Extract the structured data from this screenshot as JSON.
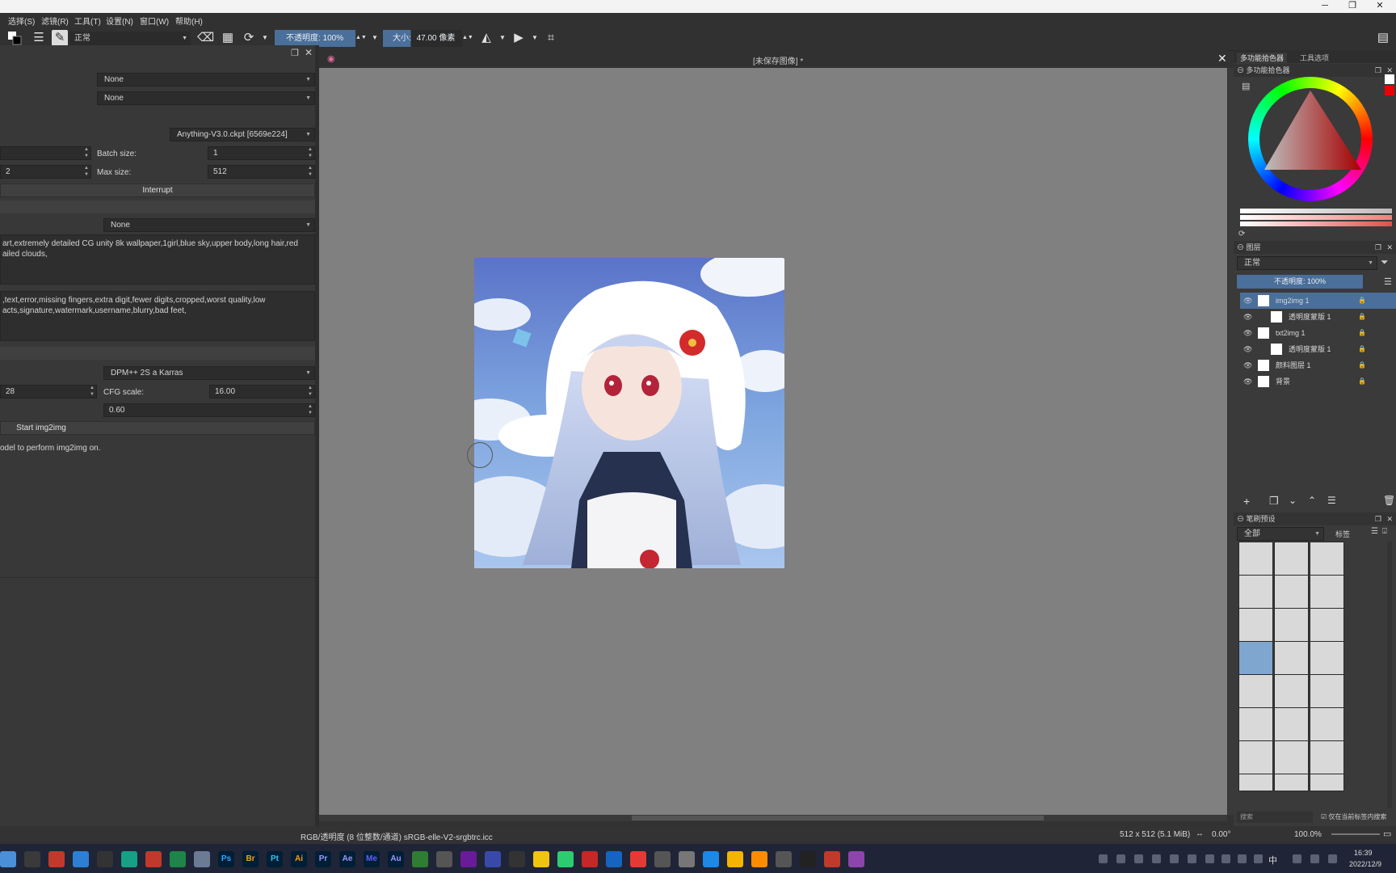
{
  "window": {
    "min": "─",
    "max": "❐",
    "close": "✕"
  },
  "menubar": [
    "选择(S)",
    "滤镜(R)",
    "工具(T)",
    "设置(N)",
    "窗口(W)",
    "帮助(H)"
  ],
  "toolbar": {
    "blend_mode": "正常",
    "opacity_label": "不透明度:",
    "opacity_value": "100%",
    "size_label": "大小:",
    "size_value": "47.00 像素"
  },
  "left_panel": {
    "combo1": "None",
    "combo2": "None",
    "model": "Anything-V3.0.ckpt [6569e224]",
    "batch_size_label": "Batch size:",
    "batch_size_value": "1",
    "max_size_label": "Max size:",
    "max_size_value": "512",
    "left_spin2_value": "2",
    "interrupt_label": "Interrupt",
    "combo3": "None",
    "prompt": "art,extremely detailed CG unity 8k wallpaper,1girl,blue sky,upper body,long hair,red\nailed clouds,",
    "negative_prompt": ",text,error,missing fingers,extra digit,fewer digits,cropped,worst quality,low\nacts,signature,watermark,username,blurry,bad feet,",
    "sampler": "DPM++ 2S a Karras",
    "steps_value": "28",
    "cfg_label": "CFG scale:",
    "cfg_value": "16.00",
    "denoise_value": "0.60",
    "start_label": "Start img2img",
    "info_text": "odel to perform img2img on."
  },
  "canvas": {
    "tab_title": "[未保存图像] *"
  },
  "status": {
    "color_info": "RGB/透明度 (8 位整数/通道)  sRGB-elle-V2-srgbtrc.icc",
    "image_size": "512 x 512 (5.1 MiB)",
    "rotation": "0.00°",
    "zoom": "100.0%"
  },
  "right_panel": {
    "tab1": "多功能拾色器",
    "tab2": "工具选项",
    "color_dock_title": "多功能拾色器",
    "layers_title": "图层",
    "layers_blend": "正常",
    "layers_opacity": "不透明度: 100%",
    "layers": [
      {
        "name": "img2img 1",
        "active": true,
        "indent": 0
      },
      {
        "name": "透明度蒙版 1",
        "active": false,
        "indent": 1
      },
      {
        "name": "txt2img 1",
        "active": false,
        "indent": 0
      },
      {
        "name": "透明度蒙版 1",
        "active": false,
        "indent": 1
      },
      {
        "name": "颜料图层 1",
        "active": false,
        "indent": 0
      },
      {
        "name": "背景",
        "active": false,
        "indent": 0
      }
    ],
    "brush_title": "笔刷预设",
    "brush_filter": "全部",
    "brush_tag": "标签",
    "brush_search": "搜索",
    "brush_checkbox": "仅在当前标签内搜索"
  },
  "taskbar": {
    "apps": [
      "Ps",
      "Br",
      "Pt",
      "Ai",
      "Pr",
      "Ae",
      "Me",
      "Au"
    ],
    "time": "16:39",
    "date": "2022/12/9",
    "ime": "中"
  },
  "colors": {
    "accent": "#4a6f9a",
    "canvas_bg": "#808080"
  }
}
